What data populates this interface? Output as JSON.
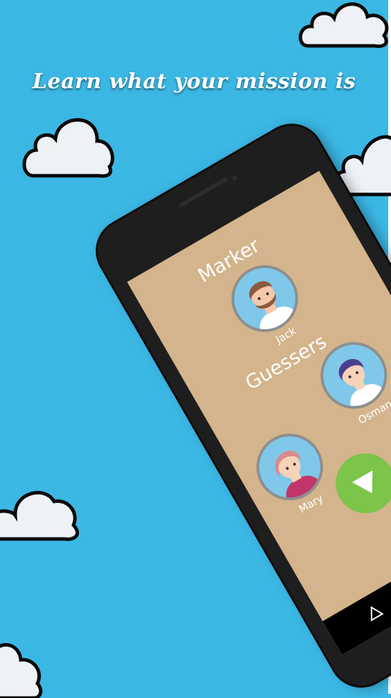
{
  "headline": "Learn what your mission is",
  "screen": {
    "marker_label": "Marker",
    "guessers_label": "Guessers",
    "players": {
      "marker": {
        "name": "Jack"
      },
      "guesser_1": {
        "name": "Osman"
      },
      "guesser_2": {
        "name": "Mary"
      }
    },
    "next_icon": "down-triangle-icon"
  },
  "colors": {
    "background": "#3bb7e4",
    "screen": "#d3b48c",
    "button": "#7cc44a",
    "cloud_fill": "#eef2f6",
    "cloud_stroke": "#0a0a0a"
  }
}
